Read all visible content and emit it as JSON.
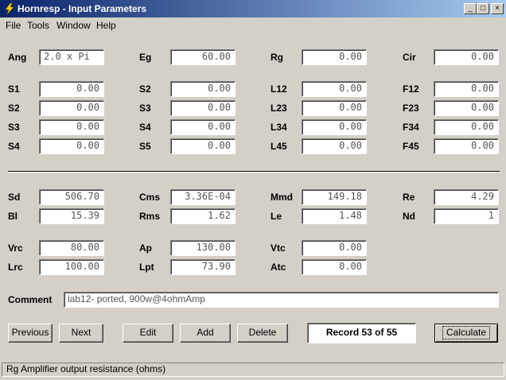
{
  "window": {
    "title": "Hornresp - Input Parameters",
    "min": "_",
    "max": "□",
    "close": "×"
  },
  "menu": [
    "File",
    "Tools",
    "Window",
    "Help"
  ],
  "row1": [
    {
      "label": "Ang",
      "value": "2.0 x Pi",
      "align": "left"
    },
    {
      "label": "Eg",
      "value": "60.00"
    },
    {
      "label": "Rg",
      "value": "0.00"
    },
    {
      "label": "Cir",
      "value": "0.00"
    }
  ],
  "segments": {
    "col1": [
      {
        "label": "S1",
        "value": "0.00"
      },
      {
        "label": "S2",
        "value": "0.00"
      },
      {
        "label": "S3",
        "value": "0.00"
      },
      {
        "label": "S4",
        "value": "0.00"
      }
    ],
    "col2": [
      {
        "label": "S2",
        "value": "0.00"
      },
      {
        "label": "S3",
        "value": "0.00"
      },
      {
        "label": "S4",
        "value": "0.00"
      },
      {
        "label": "S5",
        "value": "0.00"
      }
    ],
    "col3": [
      {
        "label": "L12",
        "value": "0.00"
      },
      {
        "label": "L23",
        "value": "0.00"
      },
      {
        "label": "L34",
        "value": "0.00"
      },
      {
        "label": "L45",
        "value": "0.00"
      }
    ],
    "col4": [
      {
        "label": "F12",
        "value": "0.00"
      },
      {
        "label": "F23",
        "value": "0.00"
      },
      {
        "label": "F34",
        "value": "0.00"
      },
      {
        "label": "F45",
        "value": "0.00"
      }
    ]
  },
  "driver": {
    "sd": {
      "label": "Sd",
      "value": "506.70"
    },
    "cms": {
      "label": "Cms",
      "value": "3.36E-04"
    },
    "mmd": {
      "label": "Mmd",
      "value": "149.18"
    },
    "re": {
      "label": "Re",
      "value": "4.29"
    },
    "bl": {
      "label": "Bl",
      "value": "15.39"
    },
    "rms": {
      "label": "Rms",
      "value": "1.62"
    },
    "le": {
      "label": "Le",
      "value": "1.48"
    },
    "nd": {
      "label": "Nd",
      "value": "1"
    }
  },
  "chamber": {
    "vrc": {
      "label": "Vrc",
      "value": "80.00"
    },
    "ap": {
      "label": "Ap",
      "value": "130.00"
    },
    "vtc": {
      "label": "Vtc",
      "value": "0.00"
    },
    "lrc": {
      "label": "Lrc",
      "value": "100.00"
    },
    "lpt": {
      "label": "Lpt",
      "value": "73.90"
    },
    "atc": {
      "label": "Atc",
      "value": "0.00"
    }
  },
  "comment": {
    "label": "Comment",
    "value": "lab12- ported, 900w@4ohmAmp"
  },
  "buttons": {
    "previous": "Previous",
    "next": "Next",
    "edit": "Edit",
    "add": "Add",
    "delete": "Delete",
    "calculate": "Calculate"
  },
  "record": "Record 53 of 55",
  "status": "Rg   Amplifier output resistance  (ohms)"
}
